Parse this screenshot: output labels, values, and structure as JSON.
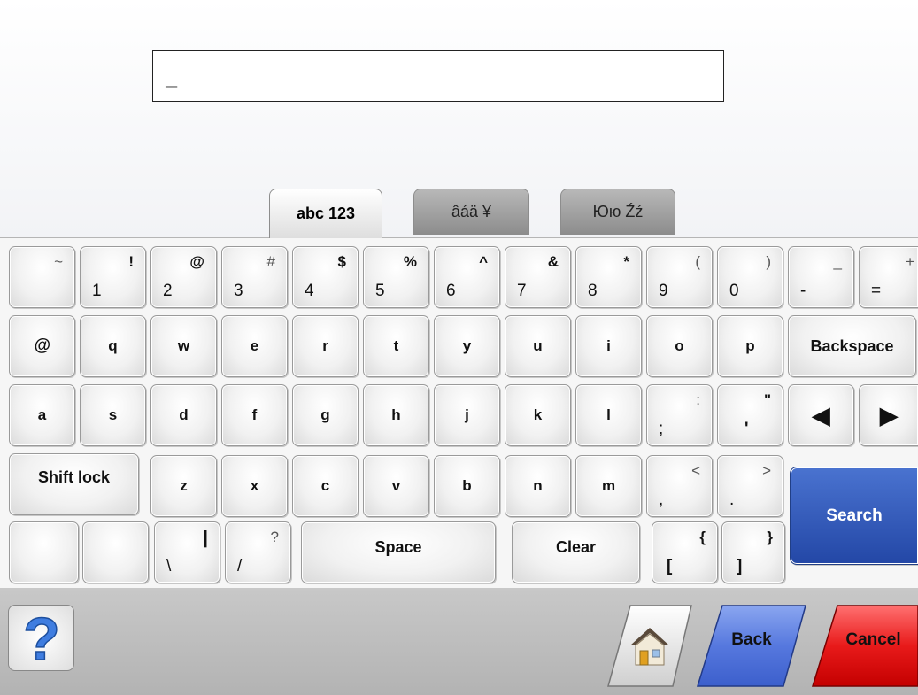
{
  "input": {
    "value": "_"
  },
  "tabs": [
    {
      "id": "abc",
      "label": "abc 123"
    },
    {
      "id": "acc",
      "label": "âáä ¥"
    },
    {
      "id": "cyr",
      "label": "Юю Źź"
    }
  ],
  "keys": {
    "row1": [
      {
        "lo": "",
        "hi": "~"
      },
      {
        "lo": "1",
        "hi": "!"
      },
      {
        "lo": "2",
        "hi": "@"
      },
      {
        "lo": "3",
        "hi": "#"
      },
      {
        "lo": "4",
        "hi": "$"
      },
      {
        "lo": "5",
        "hi": "%"
      },
      {
        "lo": "6",
        "hi": "^"
      },
      {
        "lo": "7",
        "hi": "&"
      },
      {
        "lo": "8",
        "hi": "*"
      },
      {
        "lo": "9",
        "hi": "("
      },
      {
        "lo": "0",
        "hi": ")"
      },
      {
        "lo": "-",
        "hi": "_"
      },
      {
        "lo": "=",
        "hi": "+"
      }
    ],
    "row2": [
      "@",
      "q",
      "w",
      "e",
      "r",
      "t",
      "y",
      "u",
      "i",
      "o",
      "p"
    ],
    "backspace": "Backspace",
    "row3": [
      "a",
      "s",
      "d",
      "f",
      "g",
      "h",
      "j",
      "k",
      "l"
    ],
    "row3_sym": [
      {
        "lo": ";",
        "hi": ":"
      },
      {
        "lo": "'",
        "hi": "\""
      }
    ],
    "arrow_left": "◀",
    "arrow_right": "▶",
    "shift": "Shift lock",
    "row4": [
      "z",
      "x",
      "c",
      "v",
      "b",
      "n",
      "m"
    ],
    "row4_sym": [
      {
        "lo": ",",
        "hi": "<"
      },
      {
        "lo": ".",
        "hi": ">"
      }
    ],
    "row5_sym": [
      {
        "lo": "\\",
        "hi": "|"
      },
      {
        "lo": "/",
        "hi": "?"
      }
    ],
    "space": "Space",
    "clear": "Clear",
    "row5_brackets": [
      {
        "lo": "[",
        "hi": "{"
      },
      {
        "lo": "]",
        "hi": "}"
      }
    ],
    "search": "Search"
  },
  "bottom": {
    "help": "?",
    "back": "Back",
    "cancel": "Cancel"
  },
  "colors": {
    "search": "#2f56b8",
    "back": "#4d6fd6",
    "cancel": "#d51515"
  }
}
